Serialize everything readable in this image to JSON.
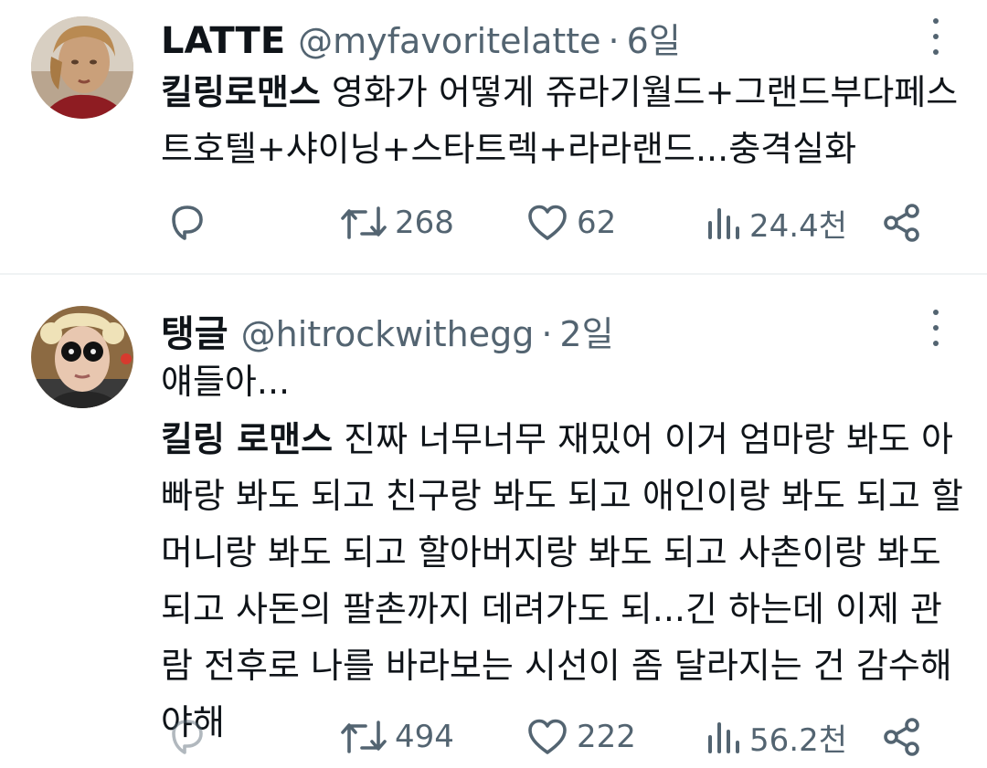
{
  "tweets": [
    {
      "name": "LATTE",
      "handle": "@myfavoritelatte",
      "separator": "·",
      "time": "6일",
      "text_bold": "킬링로맨스",
      "text_rest": " 영화가 어떻게 쥬라기월드+그랜드부다페스트호텔+샤이닝+스타트렉+라라랜드...충격실화",
      "retweets": "268",
      "likes": "62",
      "views": "24.4천"
    },
    {
      "name": "탱글",
      "handle": "@hitrockwithegg",
      "separator": "·",
      "time": "2일",
      "text_line1": "얘들아...",
      "text_bold": "킬링 로맨스",
      "text_rest": " 진짜 너무너무 재밌어 이거 엄마랑 봐도 아빠랑 봐도 되고 친구랑 봐도 되고 애인이랑 봐도 되고 할머니랑 봐도 되고 할아버지랑 봐도 되고 사촌이랑 봐도 되고 사돈의 팔촌까지 데려가도 되...긴 하는데 이제 관람 전후로 나를 바라보는 시선이 좀 달라지는 건 감수해야해",
      "retweets": "494",
      "likes": "222",
      "views": "56.2천"
    }
  ],
  "icons": {
    "reply": "reply-icon",
    "retweet": "retweet-icon",
    "like": "heart-icon",
    "views": "views-icon",
    "share": "share-icon",
    "more": "more-icon"
  },
  "colors": {
    "text": "#0f1419",
    "secondary": "#536471",
    "divider": "#eff3f4"
  }
}
